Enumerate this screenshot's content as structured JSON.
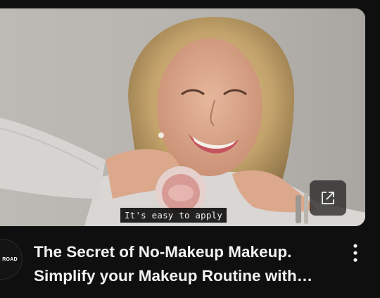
{
  "video": {
    "caption": "It's easy to apply",
    "title_line_1": "The Secret of No-Makeup Makeup.",
    "title_line_2": "Simplify your Makeup Routine with…"
  },
  "channel": {
    "avatar_text": "ROAD"
  },
  "icons": {
    "open_external": "open-in-new-icon",
    "more_options": "more-vert-icon"
  },
  "colors": {
    "background": "#0f0f0f",
    "title_text": "#f1f1f1",
    "caption_bg": "#080808",
    "thumbnail_backdrop": "#b9b6b2"
  }
}
